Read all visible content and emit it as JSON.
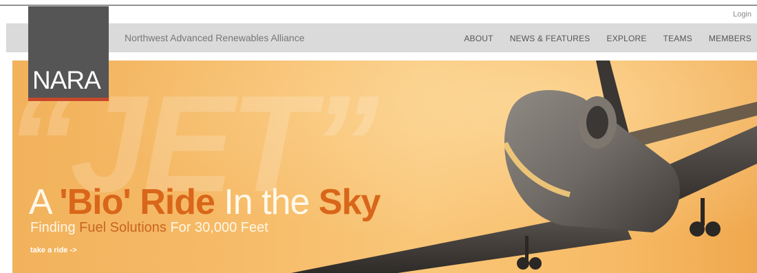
{
  "header": {
    "login": "Login",
    "org_name": "Northwest Advanced Renewables Alliance",
    "logo_text": "NARA",
    "nav": [
      "ABOUT",
      "NEWS & FEATURES",
      "EXPLORE",
      "TEAMS",
      "MEMBERS"
    ]
  },
  "hero": {
    "watermark": "“JET”",
    "headline": {
      "part1": "A ",
      "part2": "'Bio' Ride",
      "part3": " In the ",
      "part4": "Sky"
    },
    "subhead": {
      "part1": "Finding ",
      "part2": "Fuel Solutions",
      "part3": " For 30,000 Feet"
    },
    "cta": "take a ride ->"
  },
  "colors": {
    "accent_orange": "#d9661a",
    "logo_bg": "#555555",
    "logo_bar": "#c7472a",
    "nav_bg": "#dadada"
  }
}
